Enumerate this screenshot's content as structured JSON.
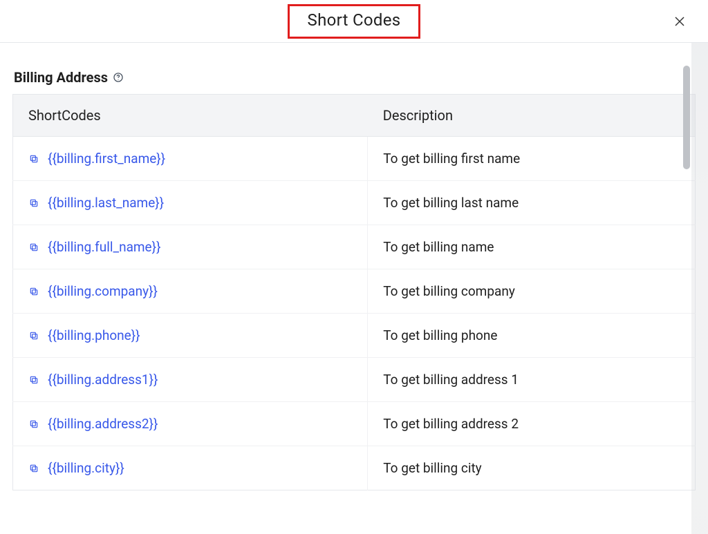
{
  "header": {
    "title": "Short Codes",
    "close_label": "Close"
  },
  "section": {
    "title": "Billing Address"
  },
  "table": {
    "headers": {
      "shortcodes": "ShortCodes",
      "description": "Description"
    },
    "rows": [
      {
        "code": "{{billing.first_name}}",
        "desc": "To get billing first name"
      },
      {
        "code": "{{billing.last_name}}",
        "desc": "To get billing last name"
      },
      {
        "code": "{{billing.full_name}}",
        "desc": "To get billing name"
      },
      {
        "code": "{{billing.company}}",
        "desc": "To get billing company"
      },
      {
        "code": "{{billing.phone}}",
        "desc": "To get billing phone"
      },
      {
        "code": "{{billing.address1}}",
        "desc": "To get billing address 1"
      },
      {
        "code": "{{billing.address2}}",
        "desc": "To get billing address 2"
      },
      {
        "code": "{{billing.city}}",
        "desc": "To get billing city"
      }
    ]
  }
}
